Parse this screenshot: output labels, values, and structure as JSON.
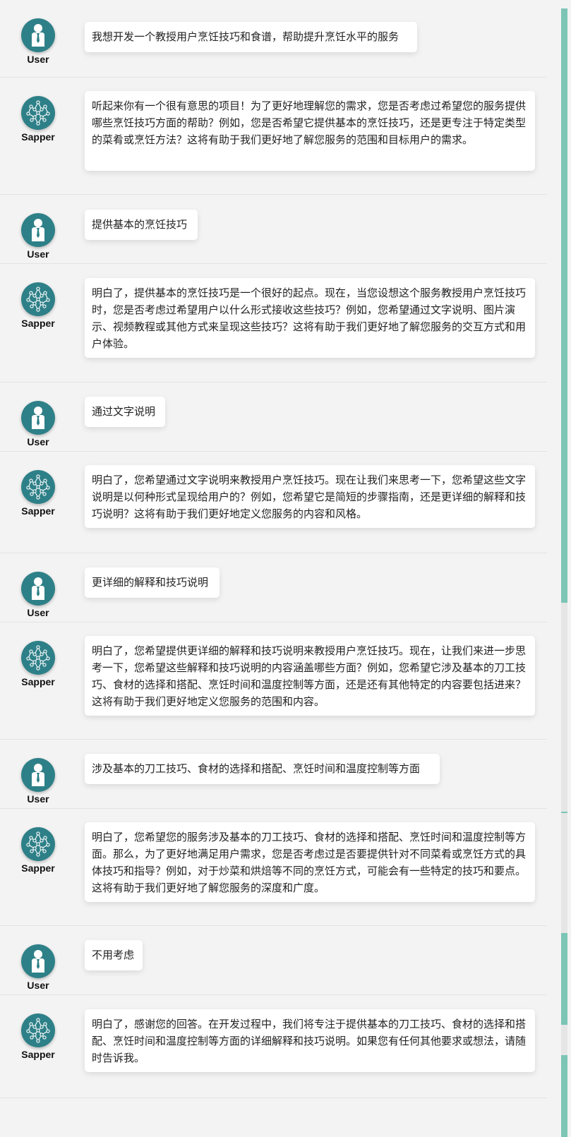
{
  "roles": {
    "user": "User",
    "sapper": "Sapper"
  },
  "icons": {
    "user": "user-avatar-icon",
    "sapper": "sapper-network-icon"
  },
  "colors": {
    "avatar_bg": "#2e8088",
    "scrollbar_thumb": "#7cc4b6",
    "background": "#f3f3f3",
    "bubble": "#ffffff"
  },
  "messages": [
    {
      "role": "user",
      "text": "我想开发一个教授用户烹饪技巧和食谱，帮助提升烹饪水平的服务"
    },
    {
      "role": "sapper",
      "text": "听起来你有一个很有意思的项目！为了更好地理解您的需求，您是否考虑过希望您的服务提供哪些烹饪技巧方面的帮助？例如，您是否希望它提供基本的烹饪技巧，还是更专注于特定类型的菜肴或烹饪方法？这将有助于我们更好地了解您服务的范围和目标用户的需求。"
    },
    {
      "role": "user",
      "text": "提供基本的烹饪技巧"
    },
    {
      "role": "sapper",
      "text": "明白了，提供基本的烹饪技巧是一个很好的起点。现在，当您设想这个服务教授用户烹饪技巧时，您是否考虑过希望用户以什么形式接收这些技巧？例如，您希望通过文字说明、图片演示、视频教程或其他方式来呈现这些技巧？这将有助于我们更好地了解您服务的交互方式和用户体验。"
    },
    {
      "role": "user",
      "text": "通过文字说明"
    },
    {
      "role": "sapper",
      "text": "明白了，您希望通过文字说明来教授用户烹饪技巧。现在让我们来思考一下，您希望这些文字说明是以何种形式呈现给用户的？例如，您希望它是简短的步骤指南，还是更详细的解释和技巧说明？这将有助于我们更好地定义您服务的内容和风格。"
    },
    {
      "role": "user",
      "text": "更详细的解释和技巧说明"
    },
    {
      "role": "sapper",
      "text": "明白了，您希望提供更详细的解释和技巧说明来教授用户烹饪技巧。现在，让我们来进一步思考一下，您希望这些解释和技巧说明的内容涵盖哪些方面？例如，您希望它涉及基本的刀工技巧、食材的选择和搭配、烹饪时间和温度控制等方面，还是还有其他特定的内容要包括进来？这将有助于我们更好地定义您服务的范围和内容。"
    },
    {
      "role": "user",
      "text": "涉及基本的刀工技巧、食材的选择和搭配、烹饪时间和温度控制等方面"
    },
    {
      "role": "sapper",
      "text": "明白了，您希望您的服务涉及基本的刀工技巧、食材的选择和搭配、烹饪时间和温度控制等方面。那么，为了更好地满足用户需求，您是否考虑过是否要提供针对不同菜肴或烹饪方式的具体技巧和指导？例如，对于炒菜和烘焙等不同的烹饪方式，可能会有一些特定的技巧和要点。这将有助于我们更好地了解您服务的深度和广度。"
    },
    {
      "role": "user",
      "text": "不用考虑"
    },
    {
      "role": "sapper",
      "text": "明白了，感谢您的回答。在开发过程中，我们将专注于提供基本的刀工技巧、食材的选择和搭配、烹饪时间和温度控制等方面的详细解释和技巧说明。如果您有任何其他要求或想法，请随时告诉我。"
    }
  ]
}
